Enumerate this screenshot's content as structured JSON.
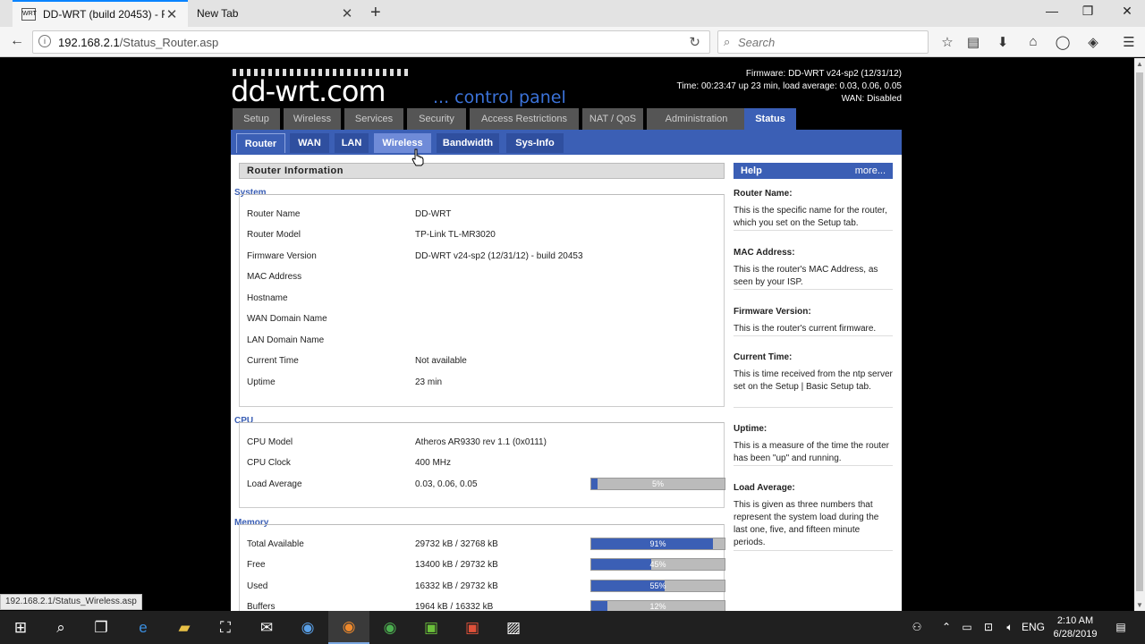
{
  "browser": {
    "tabs": [
      {
        "title": "DD-WRT (build 20453) - R..."
      },
      {
        "title": "New Tab"
      }
    ],
    "url_host": "192.168.2.1",
    "url_path": "/Status_Router.asp",
    "search_placeholder": "Search",
    "status_url": "192.168.2.1/Status_Wireless.asp"
  },
  "header": {
    "logo": "dd-wrt.com",
    "subtitle": "... control panel",
    "firmware": "Firmware: DD-WRT v24-sp2 (12/31/12)",
    "time": "Time: 00:23:47 up 23 min, load average: 0.03, 0.06, 0.05",
    "wan": "WAN: Disabled"
  },
  "main_tabs": [
    "Setup",
    "Wireless",
    "Services",
    "Security",
    "Access Restrictions",
    "NAT / QoS",
    "Administration",
    "Status"
  ],
  "sub_tabs": [
    "Router",
    "WAN",
    "LAN",
    "Wireless",
    "Bandwidth",
    "Sys-Info"
  ],
  "section_title": "Router Information",
  "system": {
    "legend": "System",
    "rows": [
      {
        "label": "Router Name",
        "value": "DD-WRT"
      },
      {
        "label": "Router Model",
        "value": "TP-Link TL-MR3020"
      },
      {
        "label": "Firmware Version",
        "value": "DD-WRT v24-sp2 (12/31/12) - build 20453"
      },
      {
        "label": "MAC Address",
        "value": ""
      },
      {
        "label": "Hostname",
        "value": ""
      },
      {
        "label": "WAN Domain Name",
        "value": ""
      },
      {
        "label": "LAN Domain Name",
        "value": ""
      },
      {
        "label": "Current Time",
        "value": "Not available"
      },
      {
        "label": "Uptime",
        "value": "23 min"
      }
    ]
  },
  "cpu": {
    "legend": "CPU",
    "rows": [
      {
        "label": "CPU Model",
        "value": "Atheros AR9330 rev 1.1 (0x0111)"
      },
      {
        "label": "CPU Clock",
        "value": "400 MHz"
      },
      {
        "label": "Load Average",
        "value": "0.03, 0.06, 0.05",
        "percent": 5,
        "percent_label": "5%"
      }
    ]
  },
  "memory": {
    "legend": "Memory",
    "rows": [
      {
        "label": "Total Available",
        "value": "29732 kB / 32768 kB",
        "percent": 91,
        "percent_label": "91%"
      },
      {
        "label": "Free",
        "value": "13400 kB / 29732 kB",
        "percent": 45,
        "percent_label": "45%"
      },
      {
        "label": "Used",
        "value": "16332 kB / 29732 kB",
        "percent": 55,
        "percent_label": "55%"
      },
      {
        "label": "Buffers",
        "value": "1964 kB / 16332 kB",
        "percent": 12,
        "percent_label": "12%"
      }
    ]
  },
  "help": {
    "title": "Help",
    "more": "more...",
    "items": [
      {
        "title": "Router Name:",
        "text": "This is the specific name for the router, which you set on the Setup tab."
      },
      {
        "title": "MAC Address:",
        "text": "This is the router's MAC Address, as seen by your ISP."
      },
      {
        "title": "Firmware Version:",
        "text": "This is the router's current firmware."
      },
      {
        "title": "Current Time:",
        "text": "This is time received from the ntp server set on the Setup | Basic Setup tab."
      },
      {
        "title": "Uptime:",
        "text": "This is a measure of the time the router has been \"up\" and running."
      },
      {
        "title": "Load Average:",
        "text": "This is given as three numbers that represent the system load during the last one, five, and fifteen minute periods."
      }
    ]
  },
  "taskbar": {
    "lang": "ENG",
    "time": "2:10 AM",
    "date": "6/28/2019"
  },
  "colors": {
    "accent": "#3b5fb5",
    "header_bg": "#000000"
  }
}
